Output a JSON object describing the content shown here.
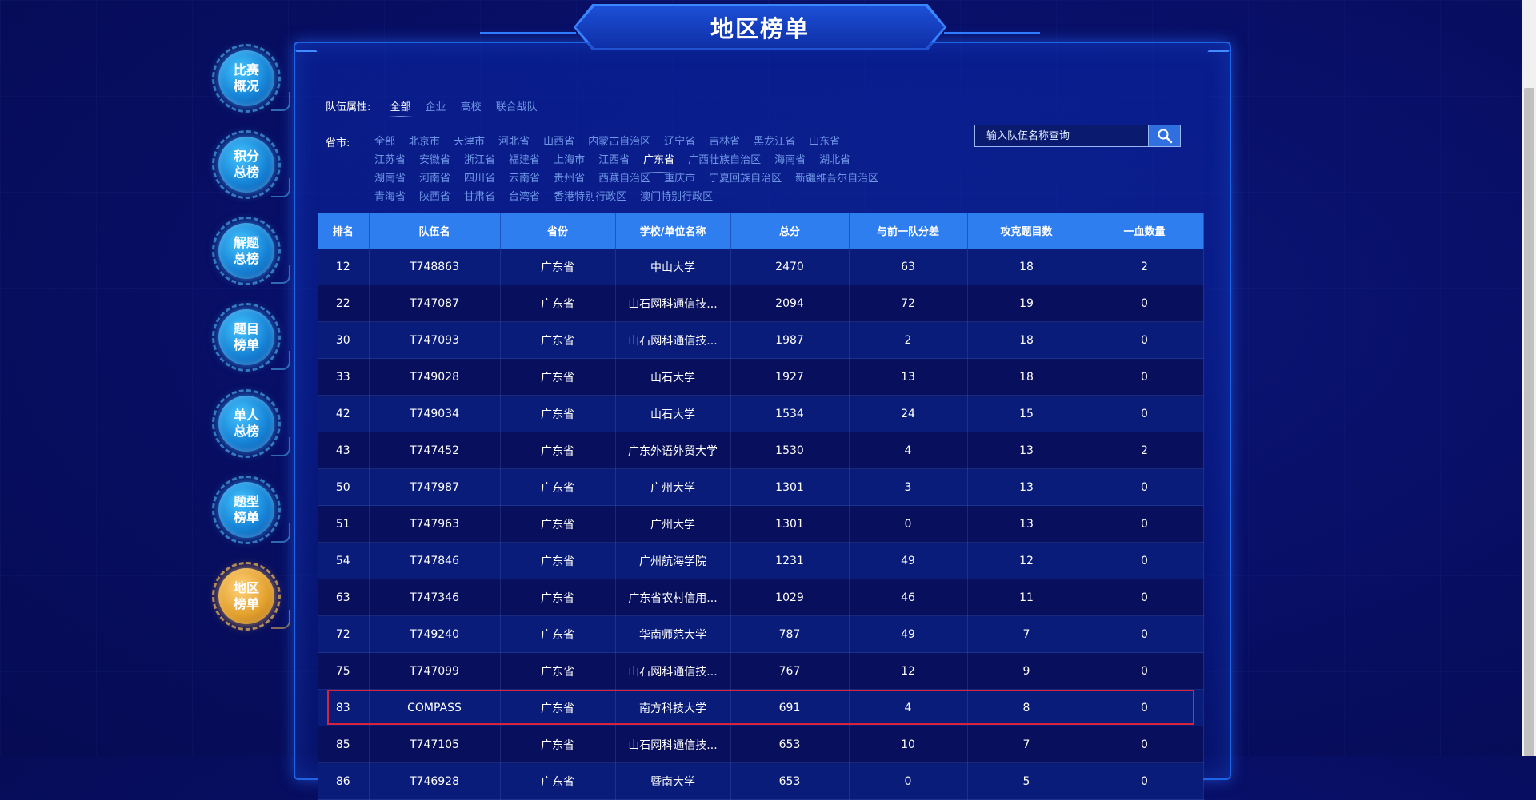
{
  "title": "地区榜单",
  "side_nav": [
    {
      "label": "比赛概况",
      "active": false
    },
    {
      "label": "积分总榜",
      "active": false
    },
    {
      "label": "解题总榜",
      "active": false
    },
    {
      "label": "题目榜单",
      "active": false
    },
    {
      "label": "单人总榜",
      "active": false
    },
    {
      "label": "题型榜单",
      "active": false
    },
    {
      "label": "地区榜单",
      "active": true
    }
  ],
  "team_type": {
    "label": "队伍属性:",
    "options": [
      "全部",
      "企业",
      "高校",
      "联合战队"
    ],
    "selected": "全部"
  },
  "province": {
    "label": "省市:",
    "options": [
      "全部",
      "北京市",
      "天津市",
      "河北省",
      "山西省",
      "内蒙古自治区",
      "辽宁省",
      "吉林省",
      "黑龙江省",
      "山东省",
      "江苏省",
      "安徽省",
      "浙江省",
      "福建省",
      "上海市",
      "江西省",
      "广东省",
      "广西壮族自治区",
      "海南省",
      "湖北省",
      "湖南省",
      "河南省",
      "四川省",
      "云南省",
      "贵州省",
      "西藏自治区",
      "重庆市",
      "宁夏回族自治区",
      "新疆维吾尔自治区",
      "青海省",
      "陕西省",
      "甘肃省",
      "台湾省",
      "香港特别行政区",
      "澳门特别行政区"
    ],
    "selected": "广东省"
  },
  "search": {
    "placeholder": "输入队伍名称查询"
  },
  "table": {
    "headers": [
      "排名",
      "队伍名",
      "省份",
      "学校/单位名称",
      "总分",
      "与前一队分差",
      "攻克题目数",
      "一血数量"
    ],
    "rows": [
      [
        "12",
        "T748863",
        "广东省",
        "中山大学",
        "2470",
        "63",
        "18",
        "2"
      ],
      [
        "22",
        "T747087",
        "广东省",
        "山石网科通信技...",
        "2094",
        "72",
        "19",
        "0"
      ],
      [
        "30",
        "T747093",
        "广东省",
        "山石网科通信技...",
        "1987",
        "2",
        "18",
        "0"
      ],
      [
        "33",
        "T749028",
        "广东省",
        "山石大学",
        "1927",
        "13",
        "18",
        "0"
      ],
      [
        "42",
        "T749034",
        "广东省",
        "山石大学",
        "1534",
        "24",
        "15",
        "0"
      ],
      [
        "43",
        "T747452",
        "广东省",
        "广东外语外贸大学",
        "1530",
        "4",
        "13",
        "2"
      ],
      [
        "50",
        "T747987",
        "广东省",
        "广州大学",
        "1301",
        "3",
        "13",
        "0"
      ],
      [
        "51",
        "T747963",
        "广东省",
        "广州大学",
        "1301",
        "0",
        "13",
        "0"
      ],
      [
        "54",
        "T747846",
        "广东省",
        "广州航海学院",
        "1231",
        "49",
        "12",
        "0"
      ],
      [
        "63",
        "T747346",
        "广东省",
        "广东省农村信用...",
        "1029",
        "46",
        "11",
        "0"
      ],
      [
        "72",
        "T749240",
        "广东省",
        "华南师范大学",
        "787",
        "49",
        "7",
        "0"
      ],
      [
        "75",
        "T747099",
        "广东省",
        "山石网科通信技...",
        "767",
        "12",
        "9",
        "0"
      ],
      [
        "83",
        "COMPASS",
        "广东省",
        "南方科技大学",
        "691",
        "4",
        "8",
        "0"
      ],
      [
        "85",
        "T747105",
        "广东省",
        "山石网科通信技...",
        "653",
        "10",
        "7",
        "0"
      ],
      [
        "86",
        "T746928",
        "广东省",
        "暨南大学",
        "653",
        "0",
        "5",
        "0"
      ]
    ],
    "highlighted_row": 12
  },
  "colors": {
    "background": "#08106a",
    "header": "#2f7ef0",
    "highlight": "#d8243a",
    "active_nav": "#e3a12e"
  }
}
